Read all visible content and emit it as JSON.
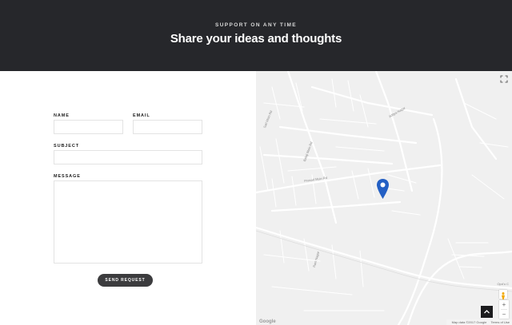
{
  "hero": {
    "eyebrow": "SUPPORT ON ANY TIME",
    "title": "Share your ideas and thoughts"
  },
  "form": {
    "name_label": "NAME",
    "email_label": "EMAIL",
    "subject_label": "SUBJECT",
    "message_label": "MESSAGE",
    "name_value": "",
    "email_value": "",
    "subject_value": "",
    "message_value": "",
    "submit_label": "SEND REQUEST"
  },
  "map": {
    "google_logo": "Google",
    "map_data": "Map data ©2017 Google",
    "terms": "Terms of Use",
    "place_label": "Opd'u C",
    "zoom_in": "+",
    "zoom_out": "−",
    "street_labels": [
      "Sarl Mein Rd",
      "Balaji Main Rd",
      "Prasad Main Rd",
      "Ram Nagar",
      "Aditya Nagar"
    ],
    "marker_color": "#2460c4"
  },
  "scroll_top_icon": "chevron-up-icon"
}
